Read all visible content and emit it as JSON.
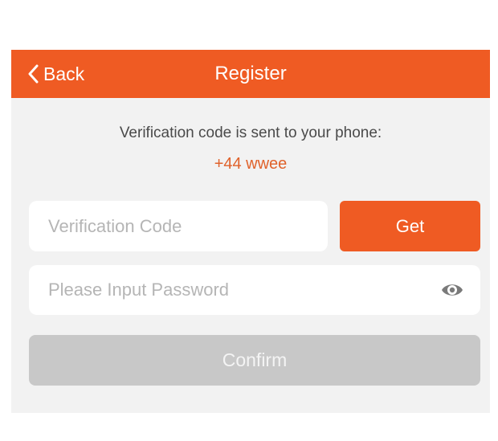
{
  "navbar": {
    "back_label": "Back",
    "title": "Register",
    "background_color": "#ef5b23"
  },
  "verification": {
    "sent_message": "Verification code is sent to your phone:",
    "phone_number": "+44 wwee",
    "phone_color": "#e0622b"
  },
  "code_field": {
    "placeholder": "Verification Code",
    "value": ""
  },
  "get_button": {
    "label": "Get"
  },
  "password_field": {
    "placeholder": "Please Input Password",
    "value": "",
    "toggle_icon": "eye-icon"
  },
  "confirm_button": {
    "label": "Confirm",
    "state": "disabled"
  }
}
